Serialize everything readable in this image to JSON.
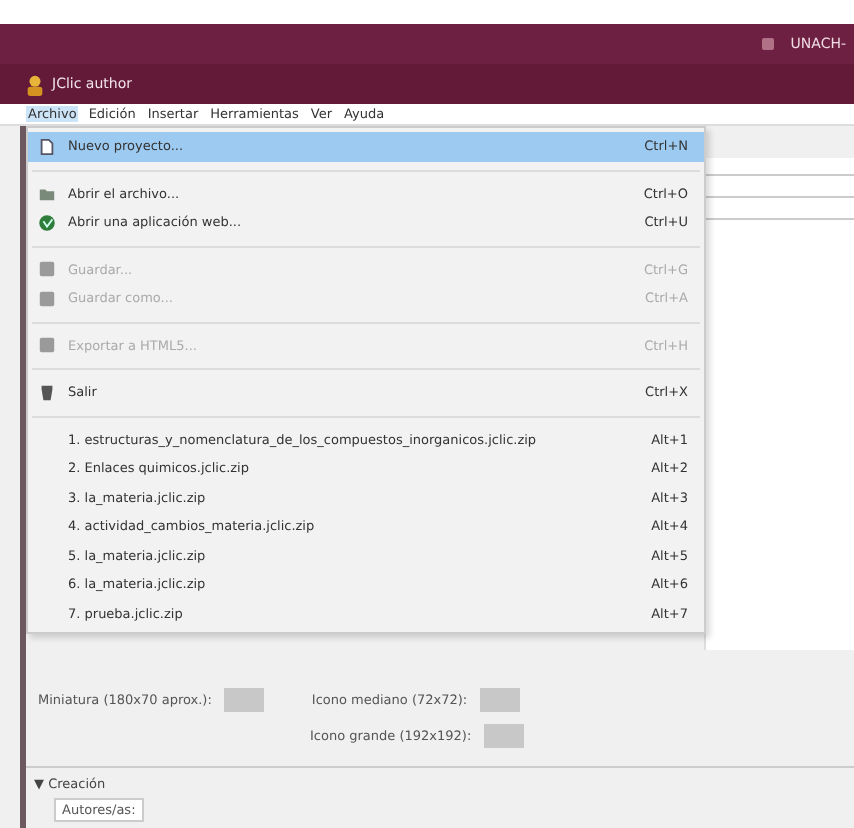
{
  "window": {
    "title": "JClic author",
    "taskbar_text": "UNACH-"
  },
  "menu_bar": [
    {
      "label": "Archivo",
      "selected": true
    },
    {
      "label": "Edición",
      "selected": false
    },
    {
      "label": "Insertar",
      "selected": false
    },
    {
      "label": "Herramientas",
      "selected": false
    },
    {
      "label": "Ver",
      "selected": false
    },
    {
      "label": "Ayuda",
      "selected": false
    }
  ],
  "file_menu": {
    "groups": [
      [
        {
          "label": "Nuevo proyecto...",
          "shortcut": "Ctrl+N",
          "disabled": false,
          "selected": true
        }
      ],
      [
        {
          "label": "Abrir el archivo...",
          "shortcut": "Ctrl+O",
          "disabled": false,
          "selected": false
        },
        {
          "label": "Abrir una aplicación web...",
          "shortcut": "Ctrl+U",
          "disabled": false,
          "selected": false
        }
      ],
      [
        {
          "label": "Guardar...",
          "shortcut": "Ctrl+G",
          "disabled": true,
          "selected": false
        },
        {
          "label": "Guardar como...",
          "shortcut": "Ctrl+A",
          "disabled": true,
          "selected": false
        }
      ],
      [
        {
          "label": "Exportar a HTML5...",
          "shortcut": "Ctrl+H",
          "disabled": true,
          "selected": false
        }
      ],
      [
        {
          "label": "Salir",
          "shortcut": "Ctrl+X",
          "disabled": false,
          "selected": false
        }
      ],
      [
        {
          "label": "1. estructuras_y_nomenclatura_de_los_compuestos_inorganicos.jclic.zip",
          "shortcut": "Alt+1",
          "disabled": false,
          "selected": false
        },
        {
          "label": "2. Enlaces quimicos.jclic.zip",
          "shortcut": "Alt+2",
          "disabled": false,
          "selected": false
        },
        {
          "label": "3. la_materia.jclic.zip",
          "shortcut": "Alt+3",
          "disabled": false,
          "selected": false
        },
        {
          "label": "4. actividad_cambios_materia.jclic.zip",
          "shortcut": "Alt+4",
          "disabled": false,
          "selected": false
        },
        {
          "label": "5. la_materia.jclic.zip",
          "shortcut": "Alt+5",
          "disabled": false,
          "selected": false
        },
        {
          "label": "6. la_materia.jclic.zip",
          "shortcut": "Alt+6",
          "disabled": false,
          "selected": false
        },
        {
          "label": "7. prueba.jclic.zip",
          "shortcut": "Alt+7",
          "disabled": false,
          "selected": false
        }
      ]
    ]
  },
  "icons_panel": {
    "thumbnail_label": "Miniatura (180x70 aprox.):",
    "medium_icon_label": "Icono mediano (72x72):",
    "large_icon_label": "Icono grande (192x192):"
  },
  "creation_section": {
    "title": "▼ Creación",
    "authors_label": "Autores/as:"
  }
}
